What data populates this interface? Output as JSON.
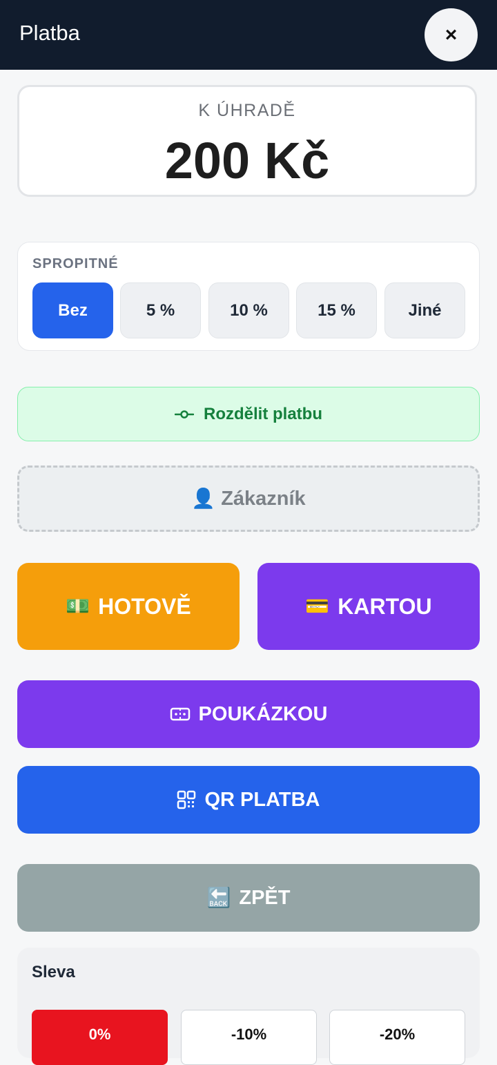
{
  "header": {
    "title": "Platba",
    "close_icon": "×"
  },
  "amount": {
    "label": "K ÚHRADĚ",
    "value": "200 Kč"
  },
  "tip": {
    "label": "SPROPITNÉ",
    "options": [
      "Bez",
      "5 %",
      "10 %",
      "15 %",
      "Jiné"
    ],
    "selected": "Bez"
  },
  "split": {
    "label": "Rozdělit platbu",
    "icon": "split-icon"
  },
  "customer": {
    "label": "Zákazník",
    "icon": "👤"
  },
  "payment": {
    "cash": {
      "label": "HOTOVĚ",
      "icon": "💵"
    },
    "card": {
      "label": "KARTOU",
      "icon": "💳"
    },
    "voucher": {
      "label": "POUKÁZKOU",
      "icon": "ticket-icon"
    },
    "qr": {
      "label": "QR PLATBA",
      "icon": "qr-icon"
    },
    "back": {
      "label": "ZPĚT",
      "icon": "🔙"
    }
  },
  "discount": {
    "title": "Sleva",
    "options": [
      "0%",
      "-10%",
      "-20%"
    ],
    "selected": "0%"
  },
  "colors": {
    "header_bg": "#111c2d",
    "tip_selected": "#2563eb",
    "cash": "#f59e0b",
    "card": "#7c3aed",
    "qr": "#2563eb",
    "back": "#95a5a6",
    "discount_selected": "#e8141f",
    "split_text": "#15803d"
  }
}
